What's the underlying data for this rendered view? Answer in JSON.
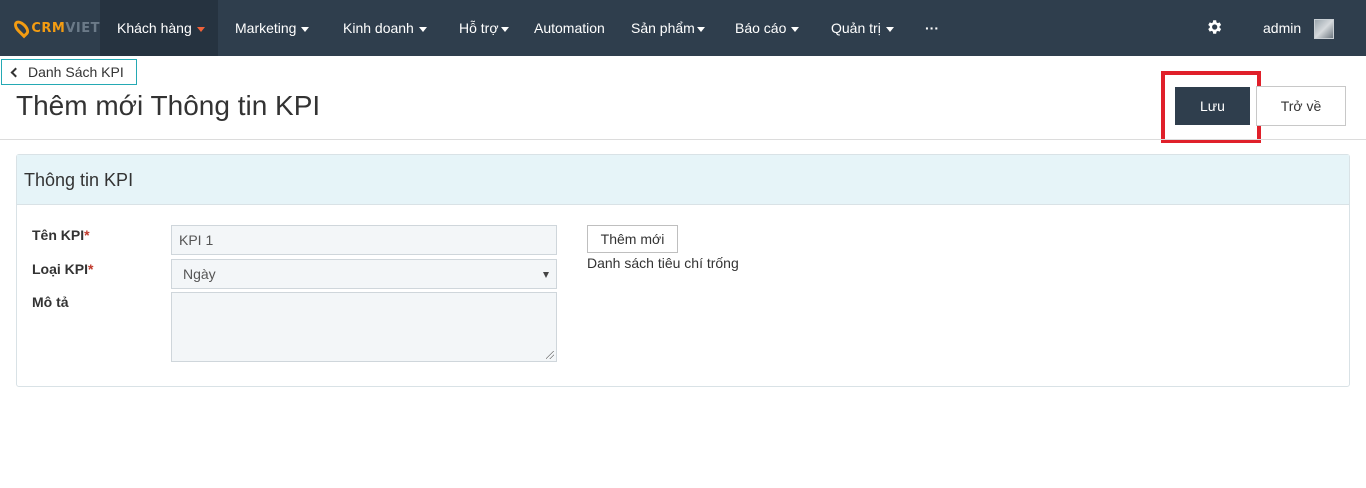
{
  "nav": {
    "logo_main": "CRM",
    "logo_dim": "VIET",
    "items": [
      {
        "label": "Khách hàng",
        "active": true
      },
      {
        "label": "Marketing"
      },
      {
        "label": "Kinh doanh"
      },
      {
        "label": "Hỗ trợ"
      },
      {
        "label": "Automation"
      },
      {
        "label": "Sản phẩm"
      },
      {
        "label": "Báo cáo"
      },
      {
        "label": "Quản trị"
      },
      {
        "label": "···"
      }
    ],
    "user": "admin",
    "icons": {
      "settings": "gear-icon",
      "dropdown": "caret-down-icon"
    }
  },
  "breadcrumb": {
    "back_label": "Danh Sách KPI"
  },
  "page": {
    "title": "Thêm mới Thông tin KPI"
  },
  "actions": {
    "save_label": "Lưu",
    "back_label": "Trở về"
  },
  "panel": {
    "title": "Thông tin KPI",
    "name": {
      "label": "Tên KPI",
      "required": "*",
      "value": "KPI 1"
    },
    "type": {
      "label": "Loại KPI",
      "required": "*",
      "value": "Ngày"
    },
    "description": {
      "label": "Mô tả",
      "value": ""
    },
    "criteria": {
      "add_label": "Thêm mới",
      "empty_text": "Danh sách tiêu chí trống"
    }
  },
  "colors": {
    "nav_bg": "#2f3e4d",
    "accent_orange": "#f39c12",
    "highlight_red": "#e0202a",
    "panel_head_bg": "#e6f4f8",
    "back_border": "#24a9b4"
  }
}
